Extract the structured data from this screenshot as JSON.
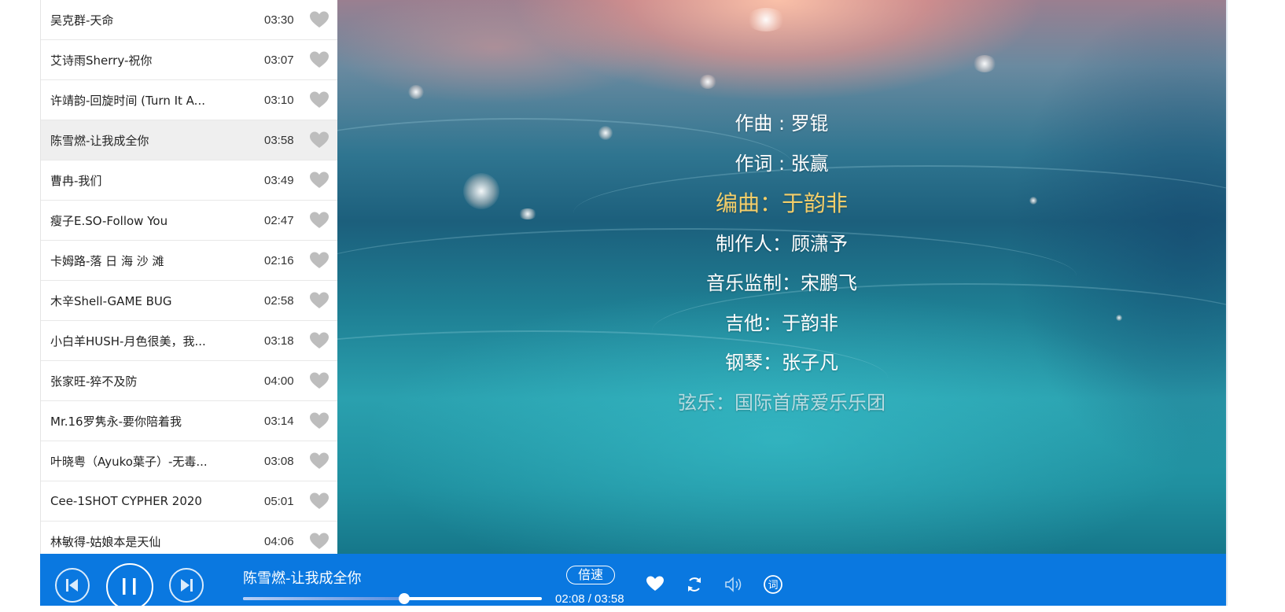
{
  "playlist": {
    "songs": [
      {
        "title": "吴克群-天命",
        "duration": "03:30"
      },
      {
        "title": "艾诗雨Sherry-祝你",
        "duration": "03:07"
      },
      {
        "title": "许靖韵-回旋时间 (Turn It A...",
        "duration": "03:10"
      },
      {
        "title": "陈雪燃-让我成全你",
        "duration": "03:58",
        "active": true
      },
      {
        "title": "曹冉-我们",
        "duration": "03:49"
      },
      {
        "title": "瘦子E.SO-Follow You",
        "duration": "02:47"
      },
      {
        "title": "卡姆路-落 日 海 沙 滩",
        "duration": "02:16"
      },
      {
        "title": "木辛Shell-GAME BUG",
        "duration": "02:58"
      },
      {
        "title": "小白羊HUSH-月色很美，我...",
        "duration": "03:18"
      },
      {
        "title": "张家旺-猝不及防",
        "duration": "04:00"
      },
      {
        "title": "Mr.16罗隽永-要你陪着我",
        "duration": "03:14"
      },
      {
        "title": "叶晓粤（Ayuko葉子）-无毒...",
        "duration": "03:08"
      },
      {
        "title": "Cee-1SHOT CYPHER 2020",
        "duration": "05:01"
      },
      {
        "title": "林敏得-姑娘本是天仙",
        "duration": "04:06"
      }
    ]
  },
  "lyrics": {
    "lines": [
      "作曲 : 罗锟",
      "作词 : 张赢",
      "编曲：于韵非",
      "制作人：顾潇予",
      "音乐监制：宋鹏飞",
      "吉他：于韵非",
      "钢琴：张子凡",
      "弦乐：国际首席爱乐乐团"
    ],
    "current_index": 2
  },
  "player": {
    "now_playing": "陈雪燃-让我成全你",
    "speed_label": "倍速",
    "time_display": "02:08 / 03:58",
    "progress": 0.54,
    "state": "playing"
  },
  "colors": {
    "bar": "#0a78e0",
    "current_lyric": "#f5cf6a",
    "heart_gray": "#bdbdbd"
  },
  "icons": [
    "prev-icon",
    "pause-icon",
    "next-icon",
    "heart-icon",
    "loop-icon",
    "volume-icon",
    "lyrics-icon"
  ]
}
